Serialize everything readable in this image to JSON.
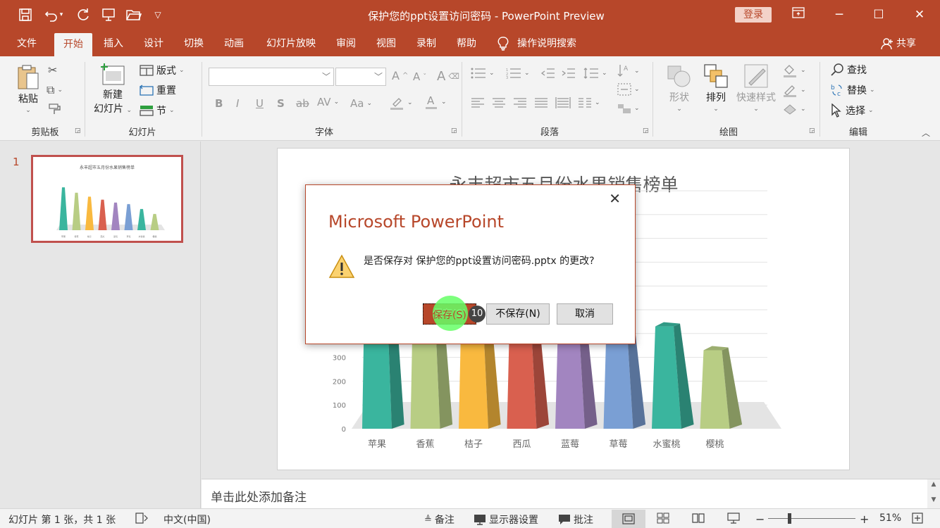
{
  "window": {
    "title": "保护您的ppt设置访问密码  -  PowerPoint Preview",
    "login_label": "登录"
  },
  "quick_access": [
    "save-icon",
    "undo-icon",
    "redo-icon",
    "present-icon",
    "open-icon",
    "customize-icon"
  ],
  "tabs": [
    {
      "label": "文件"
    },
    {
      "label": "开始"
    },
    {
      "label": "插入"
    },
    {
      "label": "设计"
    },
    {
      "label": "切换"
    },
    {
      "label": "动画"
    },
    {
      "label": "幻灯片放映"
    },
    {
      "label": "审阅"
    },
    {
      "label": "视图"
    },
    {
      "label": "录制"
    },
    {
      "label": "帮助"
    }
  ],
  "search_tab": "操作说明搜索",
  "share_label": "共享",
  "ribbon": {
    "clipboard": {
      "paste": "粘贴",
      "label": "剪贴板"
    },
    "slides": {
      "new_slide_line1": "新建",
      "new_slide_line2": "幻灯片",
      "layout": "版式",
      "reset": "重置",
      "section": "节",
      "label": "幻灯片"
    },
    "font": {
      "label": "字体",
      "bold": "B",
      "italic": "I",
      "underline": "U",
      "shadow": "S",
      "strike": "ab",
      "spacing": "AV",
      "case": "Aa"
    },
    "paragraph": {
      "label": "段落"
    },
    "drawing": {
      "shape": "形状",
      "arrange": "排列",
      "quick_styles": "快速样式",
      "label": "绘图"
    },
    "editing": {
      "find": "查找",
      "replace": "替换",
      "select": "选择",
      "label": "编辑"
    }
  },
  "thumbnail": {
    "number": "1",
    "title": "永丰超市五月份水果销售榜单"
  },
  "chart_data": {
    "type": "bar",
    "title": "永丰超市五月份水果销售榜单",
    "categories": [
      "苹果",
      "香蕉",
      "桔子",
      "西瓜",
      "蓝莓",
      "草莓",
      "水蜜桃",
      "樱桃"
    ],
    "values": [
      870,
      760,
      680,
      620,
      560,
      530,
      430,
      330
    ],
    "yticks": [
      "0",
      "100",
      "200",
      "300",
      "400"
    ],
    "ylim": [
      0,
      1000
    ],
    "colors": [
      "#3ab59e",
      "#b8cd84",
      "#f9b93f",
      "#d9604f",
      "#a285c0",
      "#7a9fd4",
      "#3ab59e",
      "#b8cd84"
    ],
    "grid": true,
    "style": "3d-pyramid"
  },
  "notes_placeholder": "单击此处添加备注",
  "status": {
    "slide_info": "幻灯片 第 1 张，共 1 张",
    "language": "中文(中国)",
    "notes": "备注",
    "display_settings": "显示器设置",
    "comments": "批注",
    "zoom": "51%"
  },
  "dialog": {
    "title": "Microsoft PowerPoint",
    "message": "是否保存对 保护您的ppt设置访问密码.pptx 的更改?",
    "save": "保存(S)",
    "dont_save": "不保存(N)",
    "cancel": "取消",
    "step_badge": "10"
  },
  "colors": {
    "accent": "#b7472a",
    "highlight": "#66ff66"
  }
}
